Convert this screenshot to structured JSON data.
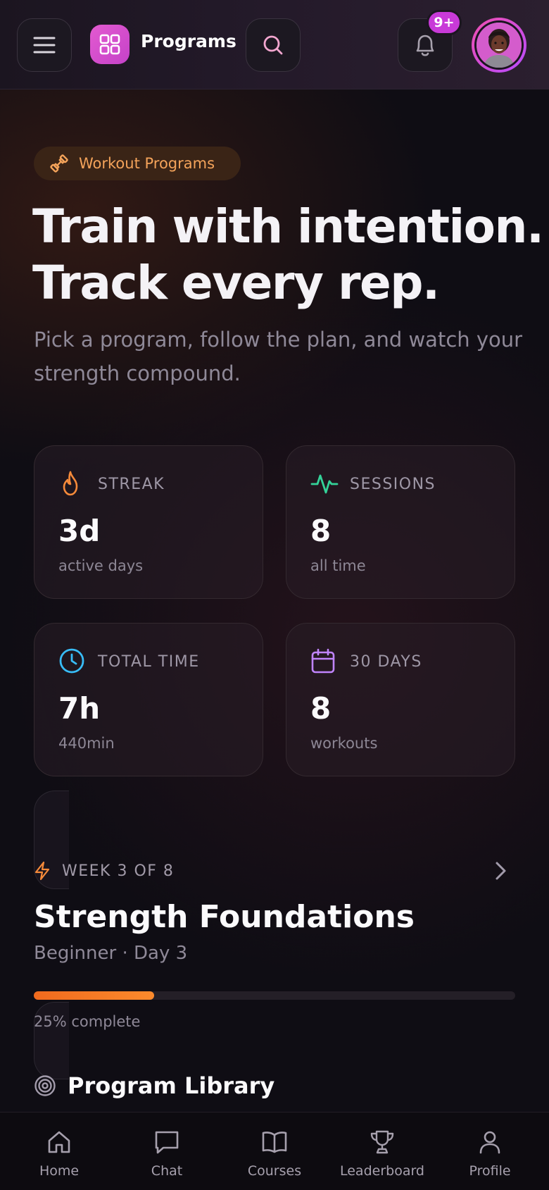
{
  "header": {
    "title": "Programs",
    "notification_badge": "9+"
  },
  "hero": {
    "tag": "Workout Programs",
    "title_line1": "Train with intention.",
    "title_line2": "Track every rep.",
    "subtitle": "Pick a program, follow the plan, and watch your strength compound."
  },
  "stats": [
    {
      "label": "STREAK",
      "value": "3d",
      "sub": "active days",
      "icon": "flame-icon",
      "color": "#f58a3a"
    },
    {
      "label": "SESSIONS",
      "value": "8",
      "sub": "all time",
      "icon": "activity-icon",
      "color": "#34d399"
    },
    {
      "label": "TOTAL TIME",
      "value": "7h",
      "sub": "440min",
      "icon": "clock-icon",
      "color": "#38bdf8"
    },
    {
      "label": "30 DAYS",
      "value": "8",
      "sub": "workouts",
      "icon": "calendar-icon",
      "color": "#c084fc"
    }
  ],
  "program": {
    "week_label": "WEEK 3 OF 8",
    "title": "Strength Foundations",
    "meta": "Beginner · Day 3",
    "progress_fraction": 0.25,
    "progress_label": "25% complete",
    "accent": "#f97316"
  },
  "library": {
    "title": "Program Library"
  },
  "nav": [
    {
      "label": "Home",
      "icon": "home-icon"
    },
    {
      "label": "Chat",
      "icon": "chat-icon"
    },
    {
      "label": "Courses",
      "icon": "book-icon"
    },
    {
      "label": "Leaderboard",
      "icon": "trophy-icon"
    },
    {
      "label": "Profile",
      "icon": "profile-icon"
    }
  ]
}
